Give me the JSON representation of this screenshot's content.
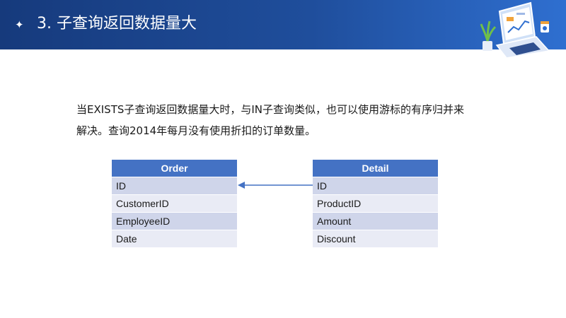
{
  "header": {
    "title": "3. 子查询返回数据量大",
    "bullet_icon": "four-point-star-icon",
    "illustration_icon": "laptop-chart-icon"
  },
  "body": {
    "line1": "当EXISTS子查询返回数据量大时，与IN子查询类似，也可以使用游标的有序归并来",
    "line2": "解决。查询2014年每月没有使用折扣的订单数量。"
  },
  "tables": {
    "order": {
      "title": "Order",
      "rows": [
        "ID",
        "CustomerID",
        "EmployeeID",
        "Date"
      ]
    },
    "detail": {
      "title": "Detail",
      "rows": [
        "ID",
        "ProductID",
        "Amount",
        "Discount"
      ]
    }
  },
  "colors": {
    "header_bg": "#1f4e9c",
    "table_header": "#4472c4",
    "row_dark": "#cfd5ea",
    "row_light": "#e9ebf5",
    "arrow": "#4472c4"
  }
}
